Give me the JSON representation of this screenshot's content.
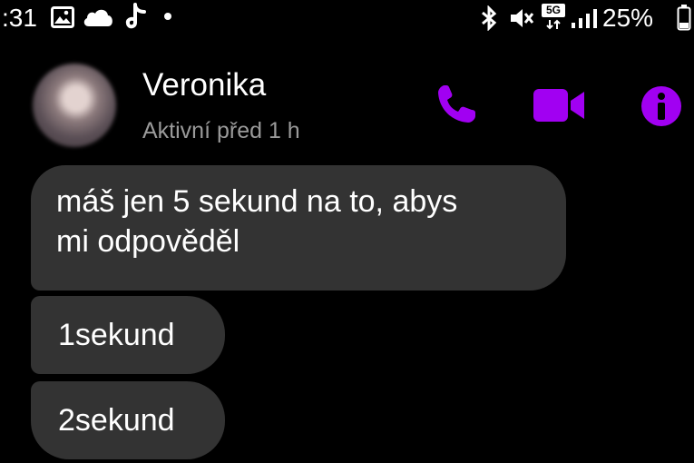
{
  "status_bar": {
    "time": ":31",
    "battery": "25%",
    "network_badge": "5G",
    "icons": [
      "gallery-icon",
      "cloud-icon",
      "tiktok-icon",
      "notification-dot-icon",
      "bluetooth-icon",
      "mute-icon",
      "network-5g-icon",
      "signal-icon",
      "battery-icon"
    ]
  },
  "header": {
    "name": "Veronika",
    "status": "Aktivní před 1 h",
    "icons": [
      "phone-icon",
      "video-icon",
      "info-icon"
    ],
    "accent_color": "#a100f2"
  },
  "messages": [
    {
      "lines": [
        "máš jen 5 sekund na to, abys",
        "mi odpověděl"
      ]
    },
    {
      "lines": [
        "1sekund"
      ]
    },
    {
      "lines": [
        "2sekund"
      ]
    }
  ],
  "colors": {
    "background": "#000000",
    "bubble": "#333333",
    "secondary_text": "#9a9a9a"
  }
}
